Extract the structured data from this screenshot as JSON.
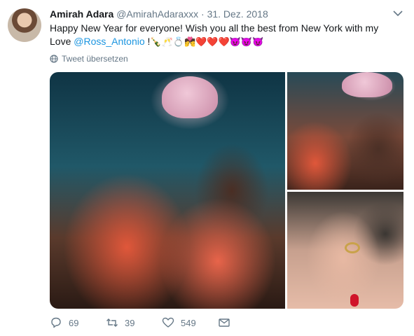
{
  "tweet": {
    "author_name": "Amirah Adara",
    "handle": "@AmirahAdaraxxx",
    "separator": "·",
    "date": "31. Dez. 2018",
    "text_line1": "Happy New Year for everyone! Wish you all the best from New York with my",
    "text_love": "Love ",
    "mention": "@Ross_Antonio",
    "text_after_mention": " !",
    "emojis": "🍾🥂💍💏❤️❤️❤️😈😈😈",
    "translate_label": "Tweet übersetzen"
  },
  "media": {
    "photos": [
      {
        "name": "photo-kiss-wide"
      },
      {
        "name": "photo-kiss-closeup"
      },
      {
        "name": "photo-engagement-ring"
      }
    ]
  },
  "actions": {
    "reply_count": "69",
    "retweet_count": "39",
    "like_count": "549"
  },
  "icons": {
    "reply": "reply-icon",
    "retweet": "retweet-icon",
    "like": "heart-icon",
    "dm": "envelope-icon",
    "caret": "chevron-down-icon",
    "translate": "globe-icon"
  },
  "colors": {
    "mention": "#1b95e0",
    "secondary_text": "#657786"
  }
}
